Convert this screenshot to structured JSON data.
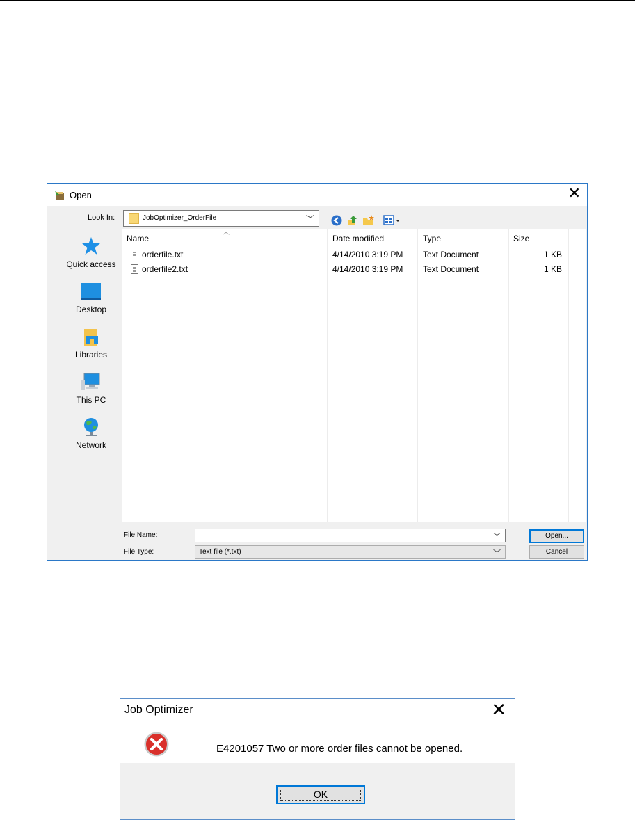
{
  "open_dialog": {
    "title": "Open",
    "close_glyph": "✕",
    "look_in": {
      "label": "Look In:",
      "value": "JobOptimizer_OrderFile"
    },
    "toolbar": {
      "icons": [
        "back-icon",
        "up-one-level-icon",
        "new-folder-icon",
        "view-menu-icon"
      ]
    },
    "places": [
      {
        "label": "Quick access",
        "icon": "quick-access-icon"
      },
      {
        "label": "Desktop",
        "icon": "desktop-icon"
      },
      {
        "label": "Libraries",
        "icon": "libraries-icon"
      },
      {
        "label": "This PC",
        "icon": "this-pc-icon"
      },
      {
        "label": "Network",
        "icon": "network-icon"
      }
    ],
    "columns": {
      "name": "Name",
      "date": "Date modified",
      "type": "Type",
      "size": "Size"
    },
    "files": [
      {
        "name": "orderfile.txt",
        "date": "4/14/2010 3:19 PM",
        "type": "Text Document",
        "size": "1 KB"
      },
      {
        "name": "orderfile2.txt",
        "date": "4/14/2010 3:19 PM",
        "type": "Text Document",
        "size": "1 KB"
      }
    ],
    "file_name": {
      "label": "File Name:",
      "value": ""
    },
    "file_type": {
      "label": "File Type:",
      "value": "Text file (*.txt)"
    },
    "buttons": {
      "open": "Open...",
      "cancel": "Cancel"
    }
  },
  "error_dialog": {
    "title": "Job Optimizer",
    "close_glyph": "✕",
    "message": "E4201057 Two or more order files cannot be opened.",
    "ok": "OK",
    "icon": "error-icon"
  },
  "colors": {
    "accent": "#0078d7",
    "error_red": "#d9302b"
  }
}
